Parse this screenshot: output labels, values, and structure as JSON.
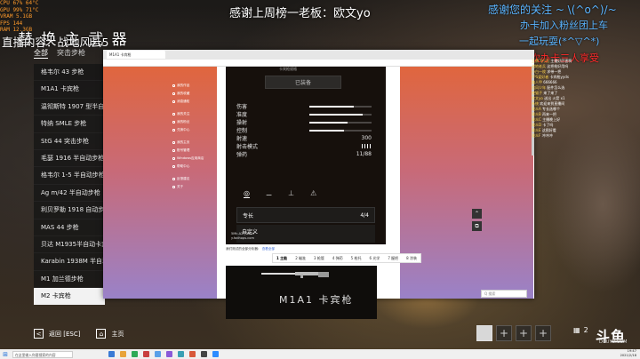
{
  "perf_overlay": {
    "lines": [
      "CPU     67%   64°C",
      "GPU     99%   71°C",
      "VRAM    5.1GB",
      "FPS     144",
      "RAM     12.3GB"
    ]
  },
  "stream": {
    "title": "直播内容：战地风云5",
    "overlay_title": "替 换 主 武 器",
    "top_banner": "感谢上周榜一老板：欧文yo",
    "right_msg1": "感谢您的关注 ~ \\(^o^)/~",
    "right_msg2": "办卡加入粉丝团上车",
    "right_msg3": "一起玩耍(*^▽^*)",
    "right_msg4": "次办卡三人享受"
  },
  "weapon_tabs": [
    {
      "label": "全部",
      "active": true
    },
    {
      "label": "突击步枪",
      "active": false
    }
  ],
  "weapon_list": [
    {
      "label": "格韦尔 43 步枪",
      "selected": false
    },
    {
      "label": "M1A1 卡宾枪",
      "selected": false
    },
    {
      "label": "温彻斯特 1907 型半自动步枪",
      "selected": false
    },
    {
      "label": "特纳 SMLE 步枪",
      "selected": false
    },
    {
      "label": "StG 44 突击步枪",
      "selected": false
    },
    {
      "label": "毛瑟 1916 半自动步枪",
      "selected": false
    },
    {
      "label": "格韦尔 1-5 半自动步枪",
      "selected": false
    },
    {
      "label": "Ag m/42 半自动步枪",
      "selected": false
    },
    {
      "label": "利贝罗勒 1918 自动步枪",
      "selected": false
    },
    {
      "label": "MAS 44 步枪",
      "selected": false
    },
    {
      "label": "贝达 M1935半自动卡宾枪",
      "selected": false
    },
    {
      "label": "Karabin 1938M 半自动",
      "selected": false
    },
    {
      "label": "M1 加兰德步枪",
      "selected": false
    },
    {
      "label": "M2 卡宾枪",
      "selected": true
    }
  ],
  "bottom_nav": {
    "back_key": "<",
    "back_label": "返回 [ESC]",
    "home_label": "主页"
  },
  "browser": {
    "tab_label": "M1A1 卡宾枪",
    "side_menu": [
      "我的作品",
      "我的收藏",
      "消息通知",
      "我的关注",
      "我的粉丝",
      "兑换中心",
      "我的主页",
      "账号管理",
      "Windows应用商店",
      "帮助中心",
      "反馈建议",
      "关于"
    ],
    "embed_top": "卡宾枪规格",
    "equipped_label": "已装备",
    "stats": [
      {
        "label": "伤害",
        "value": 0.72,
        "text": ""
      },
      {
        "label": "准度",
        "value": 0.85,
        "text": ""
      },
      {
        "label": "操射",
        "value": 0.62,
        "text": ""
      },
      {
        "label": "控制",
        "value": 0.55,
        "text": ""
      },
      {
        "label": "射速",
        "value": null,
        "text": "300"
      },
      {
        "label": "射击模式",
        "value": null,
        "text": ""
      },
      {
        "label": "弹药",
        "value": null,
        "text": "11/88"
      }
    ],
    "attachment_icons": [
      "◎",
      "⚊",
      "⊥",
      "⚠"
    ],
    "specialty_label": "专长",
    "specialty_value": "4/4",
    "customize_label": "自定义",
    "watermark": [
      "5Mk.A2 | 2019",
      "y.fadhops.com"
    ],
    "caption": "我们测试的全部分析器：",
    "caption_link": "查看全部",
    "attach_tabs": [
      "1 主能",
      "2 瞄准",
      "3 枪管",
      "4 弹药",
      "5 枪托",
      "6 光学",
      "7 握把",
      "8 涂装"
    ],
    "weapon_name": "M1A1 卡宾枪",
    "search_placeholder": "Q 搜索",
    "scroll_up": "⌃",
    "copy": "⧉"
  },
  "chat": [
    {
      "user": "王牌飞行员",
      "msg": "主播好厉害啊"
    },
    {
      "user": "战地老兵",
      "msg": "这把枪好用吗"
    },
    {
      "user": "小白一枚",
      "msg": "求带一把"
    },
    {
      "user": "FPS爱好者",
      "msg": "卡宾枪yyds"
    },
    {
      "user": "路人甲",
      "msg": "666666"
    },
    {
      "user": "追风少年",
      "msg": "配件怎么选"
    },
    {
      "user": "夜猫子",
      "msg": "来了来了"
    },
    {
      "user": "欧文yo",
      "msg": "送出 火箭 x1"
    },
    {
      "user": "系统",
      "msg": "欢迎来到直播间"
    },
    {
      "user": "观众A",
      "msg": "专长选哪个"
    },
    {
      "user": "观众B",
      "msg": "再来一把"
    },
    {
      "user": "观众C",
      "msg": "主播晚上好"
    },
    {
      "user": "观众D",
      "msg": "卡了吗"
    },
    {
      "user": "观众E",
      "msg": "这图好看"
    },
    {
      "user": "观众F",
      "msg": "冲冲冲"
    }
  ],
  "inventory": [
    "",
    "+",
    "+",
    "+"
  ],
  "player_count": "2",
  "douyu": {
    "logo": "斗鱼",
    "sub": "DOUYU.COM"
  },
  "taskbar": {
    "search": "在这里输入你要搜索的内容",
    "time": "19:47",
    "date": "2021/2/18",
    "app_colors": [
      "#3a7bd5",
      "#e8a33a",
      "#2eaa58",
      "#c84040",
      "#5aa0e8",
      "#8a5ad8",
      "#3aa0b4",
      "#d8583a",
      "#444444",
      "#2d8cff"
    ]
  }
}
